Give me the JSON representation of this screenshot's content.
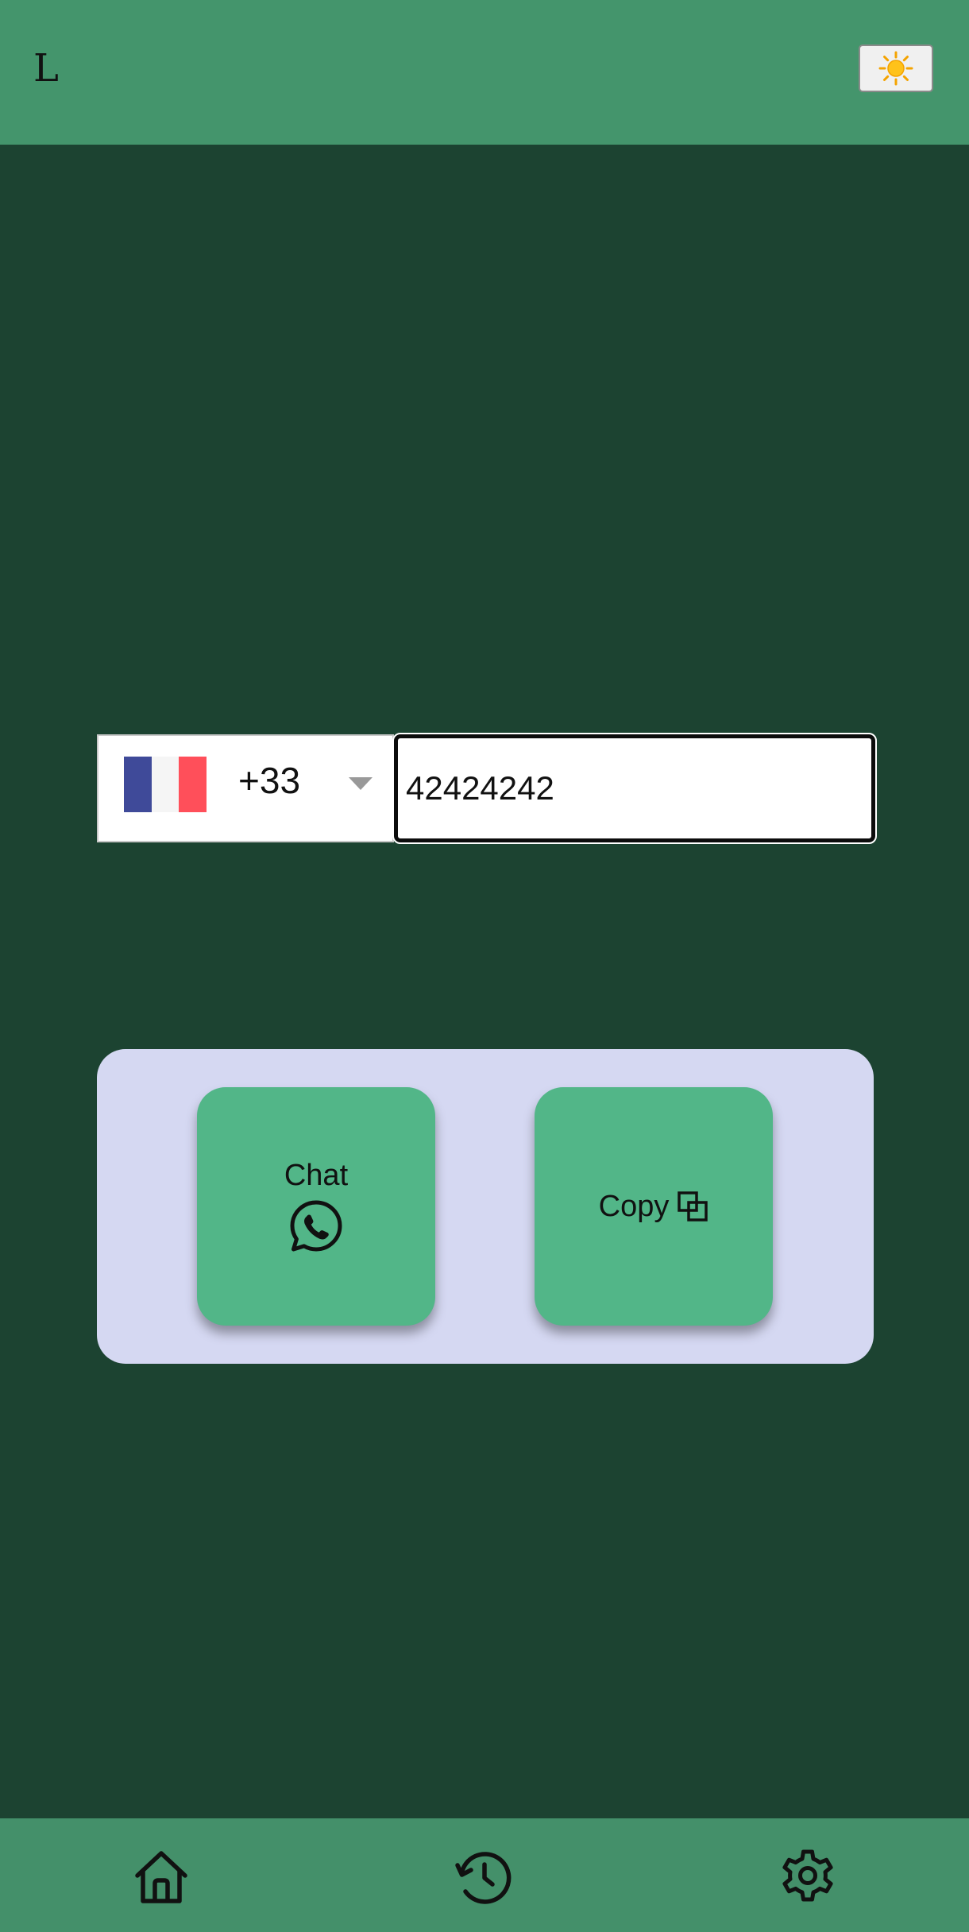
{
  "header": {
    "logo_text": "L",
    "theme_toggle_icon": "sun-icon"
  },
  "phone_form": {
    "country": {
      "flag": "france-flag",
      "flag_colors": [
        "#3f4a99",
        "#f5f5f5",
        "#ff4f5a"
      ],
      "dial_code": "+33"
    },
    "number_value": "42424242"
  },
  "actions": {
    "chat_label": "Chat",
    "chat_icon": "whatsapp-icon",
    "copy_label": "Copy",
    "copy_icon": "copy-icon"
  },
  "bottom_nav": {
    "items": [
      {
        "icon": "home-icon"
      },
      {
        "icon": "history-icon"
      },
      {
        "icon": "settings-icon"
      }
    ]
  },
  "colors": {
    "background": "#1c4331",
    "header": "#44956c",
    "panel": "#d5d8f2",
    "button": "#52b688"
  }
}
